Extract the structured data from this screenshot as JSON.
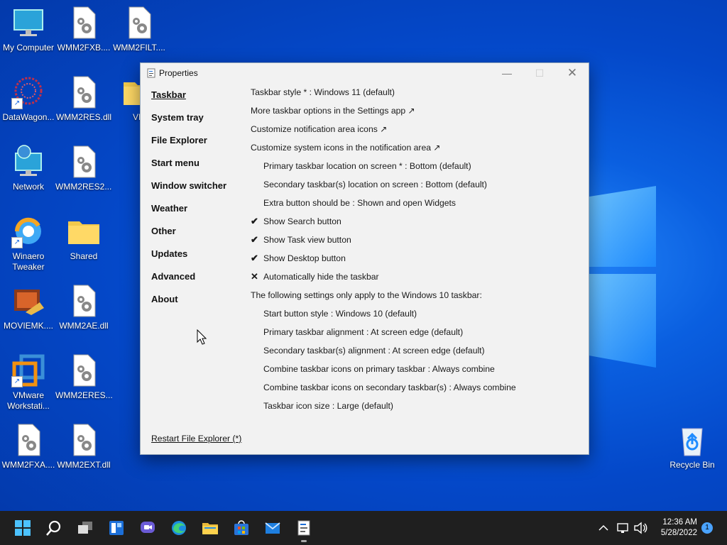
{
  "desktop": {
    "icons": [
      {
        "label": "My Computer"
      },
      {
        "label": "WMM2FXB...."
      },
      {
        "label": "WMM2FILT...."
      },
      {
        "label": "DataWagon..."
      },
      {
        "label": "WMM2RES.dll"
      },
      {
        "label": "VM"
      },
      {
        "label": "Network"
      },
      {
        "label": "WMM2RES2...."
      },
      {
        "label": "Winaero Tweaker"
      },
      {
        "label": "Shared"
      },
      {
        "label": "MOVIEMK...."
      },
      {
        "label": "WMM2AE.dll"
      },
      {
        "label": "VMware Workstati..."
      },
      {
        "label": "WMM2ERES...."
      },
      {
        "label": "WMM2FXA...."
      },
      {
        "label": "WMM2EXT.dll"
      },
      {
        "label": "Recycle Bin"
      }
    ]
  },
  "window": {
    "title": "Properties",
    "nav": [
      "Taskbar",
      "System tray",
      "File Explorer",
      "Start menu",
      "Window switcher",
      "Weather",
      "Other",
      "Updates",
      "Advanced",
      "About"
    ],
    "rows": [
      {
        "text": "Taskbar style * : Windows 11 (default)",
        "mark": ""
      },
      {
        "text": "More taskbar options in the Settings app ↗",
        "mark": ""
      },
      {
        "text": "Customize notification area icons ↗",
        "mark": ""
      },
      {
        "text": "Customize system icons in the notification area ↗",
        "mark": ""
      },
      {
        "text": "Primary taskbar location on screen * : Bottom (default)",
        "mark": ""
      },
      {
        "text": "Secondary taskbar(s) location on screen : Bottom (default)",
        "mark": ""
      },
      {
        "text": "Extra button should be : Shown and open Widgets",
        "mark": ""
      },
      {
        "text": "Show Search button",
        "mark": "✔"
      },
      {
        "text": "Show Task view button",
        "mark": "✔"
      },
      {
        "text": "Show Desktop button",
        "mark": "✔"
      },
      {
        "text": "Automatically hide the taskbar",
        "mark": "✕"
      },
      {
        "text": "The following settings only apply to the Windows 10 taskbar:",
        "mark": ""
      },
      {
        "text": "Start button style : Windows 10 (default)",
        "mark": ""
      },
      {
        "text": "Primary taskbar alignment : At screen edge (default)",
        "mark": ""
      },
      {
        "text": "Secondary taskbar(s) alignment : At screen edge (default)",
        "mark": ""
      },
      {
        "text": "Combine taskbar icons on primary taskbar : Always combine",
        "mark": ""
      },
      {
        "text": "Combine taskbar icons on secondary taskbar(s) : Always combine",
        "mark": ""
      },
      {
        "text": "Taskbar icon size : Large (default)",
        "mark": ""
      }
    ],
    "restart_link": "Restart File Explorer (*)"
  },
  "taskbar": {
    "time": "12:36 AM",
    "date": "5/28/2022",
    "notification_count": "1"
  },
  "colors": {
    "wallpaper": "#0448c9",
    "window_bg": "#f2f2f2",
    "taskbar": "#1f1f1f",
    "accent": "#4aa3ff"
  }
}
